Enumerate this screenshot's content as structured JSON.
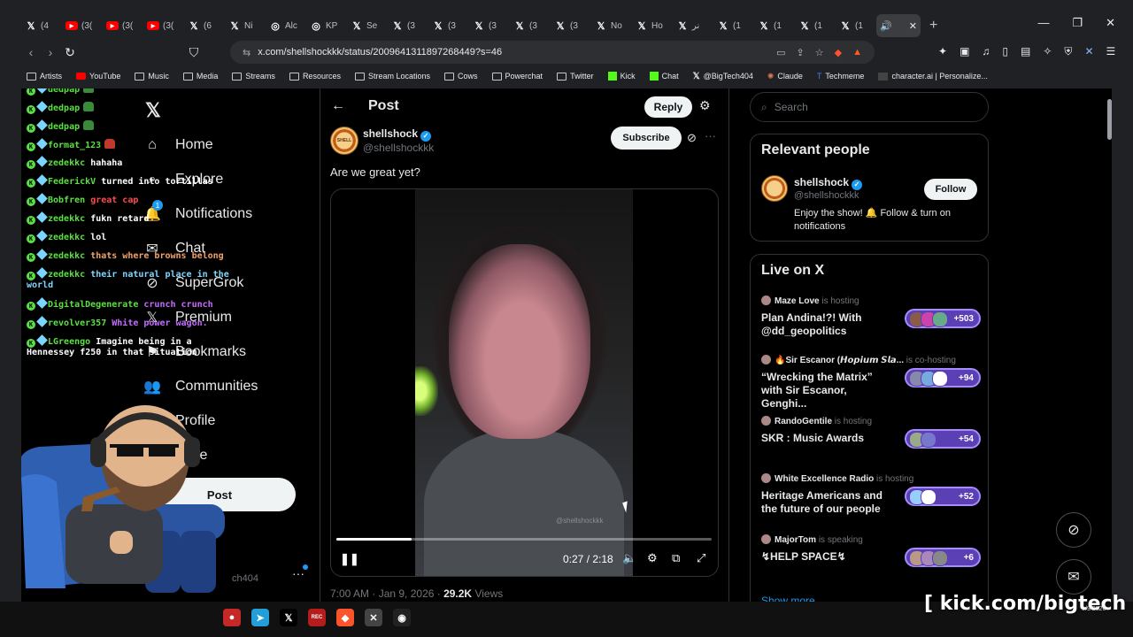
{
  "browser": {
    "tabs": [
      {
        "icon": "X",
        "label": "(4"
      },
      {
        "icon": "yt",
        "label": "(3("
      },
      {
        "icon": "yt",
        "label": "(3("
      },
      {
        "icon": "yt",
        "label": "(3("
      },
      {
        "icon": "X",
        "label": "(6"
      },
      {
        "icon": "X",
        "label": "Ni"
      },
      {
        "icon": "globe",
        "label": "Alc"
      },
      {
        "icon": "globe",
        "label": "KP"
      },
      {
        "icon": "X",
        "label": "Se"
      },
      {
        "icon": "X",
        "label": "(3"
      },
      {
        "icon": "X",
        "label": "(3"
      },
      {
        "icon": "X",
        "label": "(3"
      },
      {
        "icon": "X",
        "label": "(3"
      },
      {
        "icon": "X",
        "label": "(3"
      },
      {
        "icon": "X",
        "label": "No"
      },
      {
        "icon": "X",
        "label": "Ho"
      },
      {
        "icon": "X",
        "label": "نر"
      },
      {
        "icon": "X",
        "label": "(1"
      },
      {
        "icon": "X",
        "label": "(1"
      },
      {
        "icon": "X",
        "label": "(1"
      },
      {
        "icon": "X",
        "label": "(1"
      }
    ],
    "active_tab_icon": "speaker-icon",
    "url": "x.com/shellshockkk/status/2009641311897268449?s=46",
    "bookmarks": [
      {
        "type": "folder",
        "label": "Artists"
      },
      {
        "type": "yt",
        "label": "YouTube"
      },
      {
        "type": "folder",
        "label": "Music"
      },
      {
        "type": "folder",
        "label": "Media"
      },
      {
        "type": "folder",
        "label": "Streams"
      },
      {
        "type": "folder",
        "label": "Resources"
      },
      {
        "type": "folder",
        "label": "Stream Locations"
      },
      {
        "type": "folder",
        "label": "Cows"
      },
      {
        "type": "folder",
        "label": "Powerchat"
      },
      {
        "type": "folder",
        "label": "Twitter"
      },
      {
        "type": "kick",
        "label": "Kick"
      },
      {
        "type": "kick",
        "label": "Chat"
      },
      {
        "type": "x",
        "label": "@BigTech404"
      },
      {
        "type": "claude",
        "label": "Claude"
      },
      {
        "type": "tm",
        "label": "Techmeme"
      },
      {
        "type": "cai",
        "label": "character.ai | Personalize..."
      }
    ]
  },
  "chat": [
    {
      "user": "dedpap",
      "msg": "",
      "color": "#5be043"
    },
    {
      "user": "dedpap",
      "msg": "",
      "color": "#5be043"
    },
    {
      "user": "dedpap",
      "msg": "",
      "color": "#5be043"
    },
    {
      "user": "format_123",
      "msg": "",
      "color": "#5be043"
    },
    {
      "user": "zedekkc",
      "msg": "hahaha",
      "color": "#5be043"
    },
    {
      "user": "FederickV",
      "msg": "turned into tortillas",
      "color": "#5be043"
    },
    {
      "user": "Bobfren",
      "msg": "great cap",
      "color": "#5be043"
    },
    {
      "user": "zedekkc",
      "msg": "fukn retard",
      "color": "#5be043"
    },
    {
      "user": "zedekkc",
      "msg": "lol",
      "color": "#5be043"
    },
    {
      "user": "zedekkc",
      "msg": "thats where browns belong",
      "color": "#5be043"
    },
    {
      "user": "zedekkc",
      "msg": "their natural place in the world",
      "color": "#5be043"
    },
    {
      "user": "DigitalDegenerate",
      "msg": "crunch crunch",
      "color": "#5be043"
    },
    {
      "user": "revolver357",
      "msg": "White power wagon.",
      "color": "#5be043"
    },
    {
      "user": "LGreengo",
      "msg": "Imagine being in a Hennessey f250 in that situation",
      "color": "#5be043"
    }
  ],
  "nav": {
    "items": [
      "Home",
      "Explore",
      "Notifications",
      "Chat",
      "SuperGrok",
      "Premium",
      "Bookmarks",
      "Communities",
      "Profile",
      "More"
    ],
    "notif_count": "1",
    "post_label": "Post",
    "account_handle": "ch404"
  },
  "post": {
    "header_title": "Post",
    "reply_label": "Reply",
    "author_name": "shellshock",
    "author_handle": "@shellshockkk",
    "subscribe_label": "Subscribe",
    "text": "Are we great yet?",
    "video_watermark": "@shellshockkk",
    "video_time": "0:27 / 2:18",
    "video_progress": 0.2,
    "timestamp": "7:00 AM · Jan 9, 2026 · ",
    "views_count": "29.2K",
    "views_label": "Views"
  },
  "sidebar": {
    "search_placeholder": "Search",
    "relevant_title": "Relevant people",
    "relevant": {
      "name": "shellshock",
      "handle": "@shellshockkk",
      "follow_label": "Follow",
      "bio": "Enjoy the show! 🔔 Follow & turn on notifications"
    },
    "live_title": "Live on X",
    "live": [
      {
        "host": "Maze Love",
        "role": "is hosting",
        "title": "Plan Andina!?! With @dd_geopolitics",
        "count": "+503"
      },
      {
        "host": "🔥Sir Escanor (𝙃𝙤𝙥𝙞𝙪𝙢 𝙎𝙡𝙖...",
        "role": "is co-hosting",
        "title": "“Wrecking the Matrix” with Sir Escanor, Genghi...",
        "count": "+94"
      },
      {
        "host": "RandoGentile",
        "role": "is hosting",
        "title": "SKR : Music Awards",
        "count": "+54"
      },
      {
        "host": "White Excellence Radio",
        "role": "is hosting",
        "title": "Heritage Americans and the future of our people",
        "count": "+52"
      },
      {
        "host": "MajorTom",
        "role": "is speaking",
        "title": "↯HELP SPACE↯",
        "count": "+6"
      }
    ],
    "show_more": "Show more"
  },
  "overlay": {
    "kick_url": "[ kick.com/bigtech ]",
    "tray_time": "1/9/2026"
  }
}
